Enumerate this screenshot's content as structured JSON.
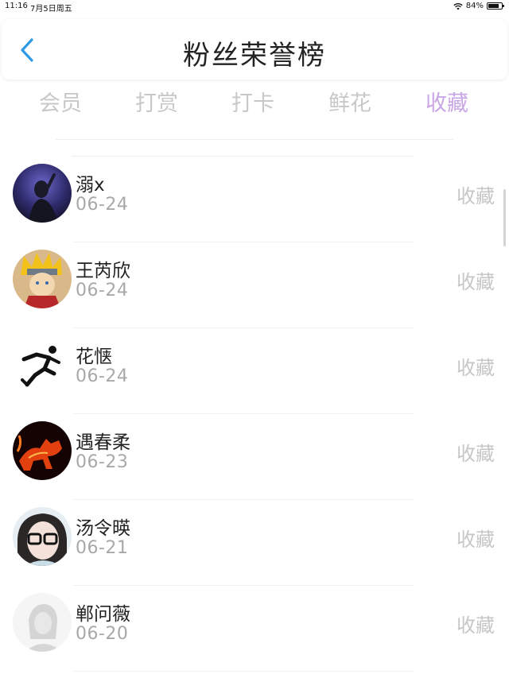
{
  "status_bar": {
    "time": "11:16",
    "date": "7月5日周五",
    "battery_percent_text": "84%",
    "battery_level": 0.84
  },
  "header": {
    "title": "粉丝荣誉榜",
    "back_icon": "chevron-left-icon",
    "back_color": "#2f9be6"
  },
  "tabs": [
    {
      "label": "会员",
      "active": false
    },
    {
      "label": "打赏",
      "active": false
    },
    {
      "label": "打卡",
      "active": false
    },
    {
      "label": "鲜花",
      "active": false
    },
    {
      "label": "收藏",
      "active": true
    }
  ],
  "colors": {
    "tab_active": "#c9a6e6",
    "tab_inactive": "#c8c8c8",
    "date_text": "#a8a8a8",
    "action_text": "#c6c6c6"
  },
  "fans": [
    {
      "name": "溺x",
      "date": "06-24",
      "action": "收藏",
      "avatar": "concert-photo-avatar"
    },
    {
      "name": "王芮欣",
      "date": "06-24",
      "action": "收藏",
      "avatar": "anime-character-avatar"
    },
    {
      "name": "花惬",
      "date": "06-24",
      "action": "收藏",
      "avatar": "running-figure-avatar"
    },
    {
      "name": "遇春柔",
      "date": "06-23",
      "action": "收藏",
      "avatar": "fire-horse-avatar"
    },
    {
      "name": "汤令暎",
      "date": "06-21",
      "action": "收藏",
      "avatar": "glasses-portrait-avatar"
    },
    {
      "name": "郸问薇",
      "date": "06-20",
      "action": "收藏",
      "avatar": "faded-portrait-avatar"
    }
  ]
}
